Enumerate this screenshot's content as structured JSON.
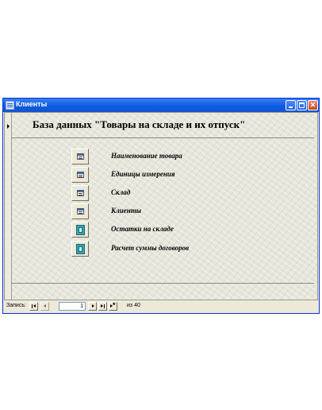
{
  "window": {
    "title": "Клиенты"
  },
  "form": {
    "title": "База данных \"Товары на складе и их отпуск\"",
    "items": [
      {
        "label": "Наименование товара",
        "icon": "form-icon"
      },
      {
        "label": "Единицы измерения",
        "icon": "form-icon"
      },
      {
        "label": "Склад",
        "icon": "form-icon"
      },
      {
        "label": "Клиенты",
        "icon": "form-icon"
      },
      {
        "label": "Остатки на складе",
        "icon": "report-icon"
      },
      {
        "label": "Расчет суммы договоров",
        "icon": "report-icon"
      }
    ]
  },
  "navigator": {
    "label": "Запись:",
    "current": "1",
    "of_text": "из 40"
  }
}
